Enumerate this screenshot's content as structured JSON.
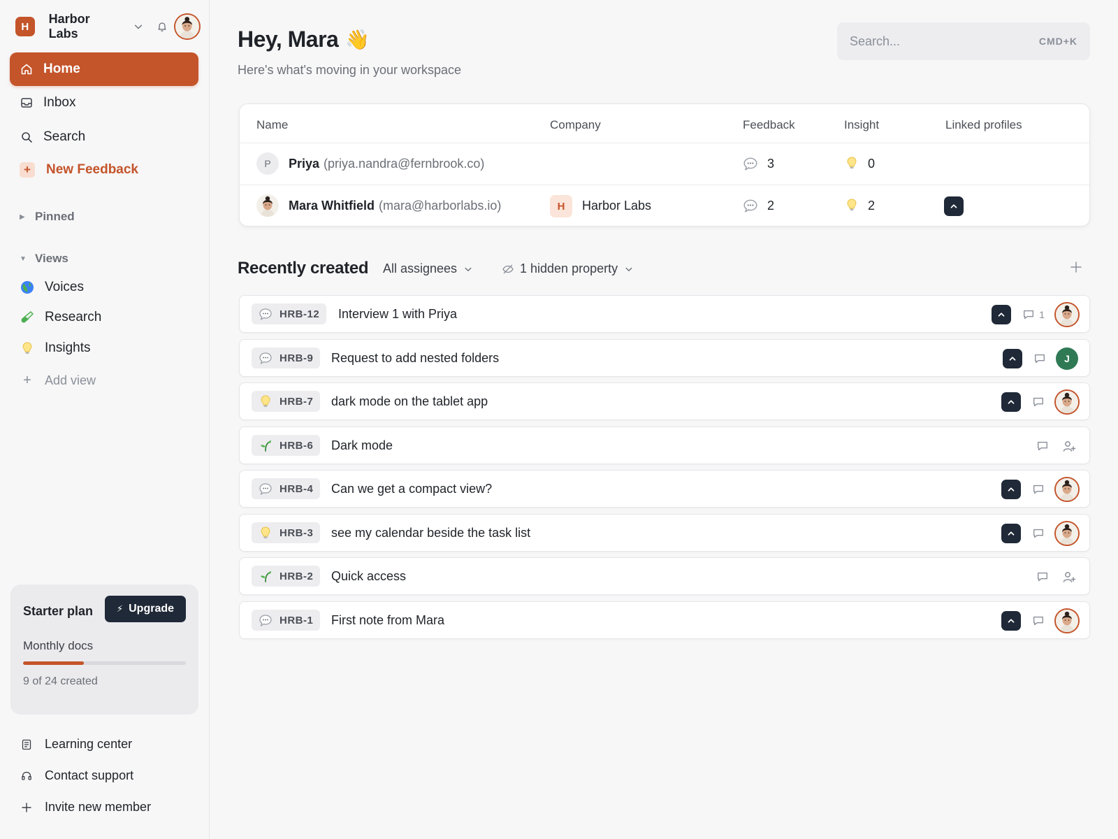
{
  "workspace": {
    "initial": "H",
    "name": "Harbor Labs"
  },
  "nav": {
    "home": "Home",
    "inbox": "Inbox",
    "search": "Search",
    "new_feedback": "New Feedback"
  },
  "sections": {
    "pinned": "Pinned",
    "views": "Views",
    "views_items": [
      {
        "label": "Voices",
        "icon": "globe-icon"
      },
      {
        "label": "Research",
        "icon": "test-tube-icon"
      },
      {
        "label": "Insights",
        "icon": "lightbulb-icon"
      }
    ],
    "add_view": "Add view"
  },
  "plan": {
    "title": "Starter plan",
    "upgrade_label": "Upgrade",
    "usage_label": "Monthly docs",
    "usage_text": "9 of 24 created",
    "used": 9,
    "total": 24
  },
  "footer": {
    "learning": "Learning center",
    "support": "Contact support",
    "invite": "Invite new member"
  },
  "header": {
    "greeting": "Hey, Mara",
    "wave": "👋",
    "subtitle": "Here's what's moving in your workspace"
  },
  "search": {
    "placeholder": "Search...",
    "shortcut": "CMD+K"
  },
  "people": {
    "columns": [
      "Name",
      "Company",
      "Feedback",
      "Insight",
      "Linked profiles"
    ],
    "rows": [
      {
        "initial": "P",
        "name": "Priya",
        "email": "(priya.nandra@fernbrook.co)",
        "company_initial": "",
        "company": "",
        "feedback": "3",
        "insight": "0"
      },
      {
        "initial": "",
        "name": "Mara Whitfield",
        "email": "(mara@harborlabs.io)",
        "company_initial": "H",
        "company": "Harbor Labs",
        "feedback": "2",
        "insight": "2"
      }
    ]
  },
  "recent": {
    "title": "Recently created",
    "filter_assignees": "All assignees",
    "filter_hidden": "1 hidden property",
    "items": [
      {
        "id": "HRB-12",
        "title": "Interview 1 with Priya",
        "type": "chat-bubble-icon",
        "comments": "1"
      },
      {
        "id": "HRB-9",
        "title": "Request to add nested folders",
        "type": "chat-bubble-icon",
        "assignee_initial": "J"
      },
      {
        "id": "HRB-7",
        "title": "dark mode on the tablet app",
        "type": "lightbulb-icon"
      },
      {
        "id": "HRB-6",
        "title": "Dark mode",
        "type": "sprout-icon"
      },
      {
        "id": "HRB-4",
        "title": "Can we get a compact view?",
        "type": "chat-bubble-icon"
      },
      {
        "id": "HRB-3",
        "title": "see my calendar beside the task list",
        "type": "lightbulb-icon"
      },
      {
        "id": "HRB-2",
        "title": "Quick access",
        "type": "sprout-icon"
      },
      {
        "id": "HRB-1",
        "title": "First note from Mara",
        "type": "chat-bubble-icon"
      }
    ]
  },
  "colors": {
    "accent": "#c4542a",
    "dark": "#1f2937",
    "assignee_j": "#2f7a54"
  }
}
